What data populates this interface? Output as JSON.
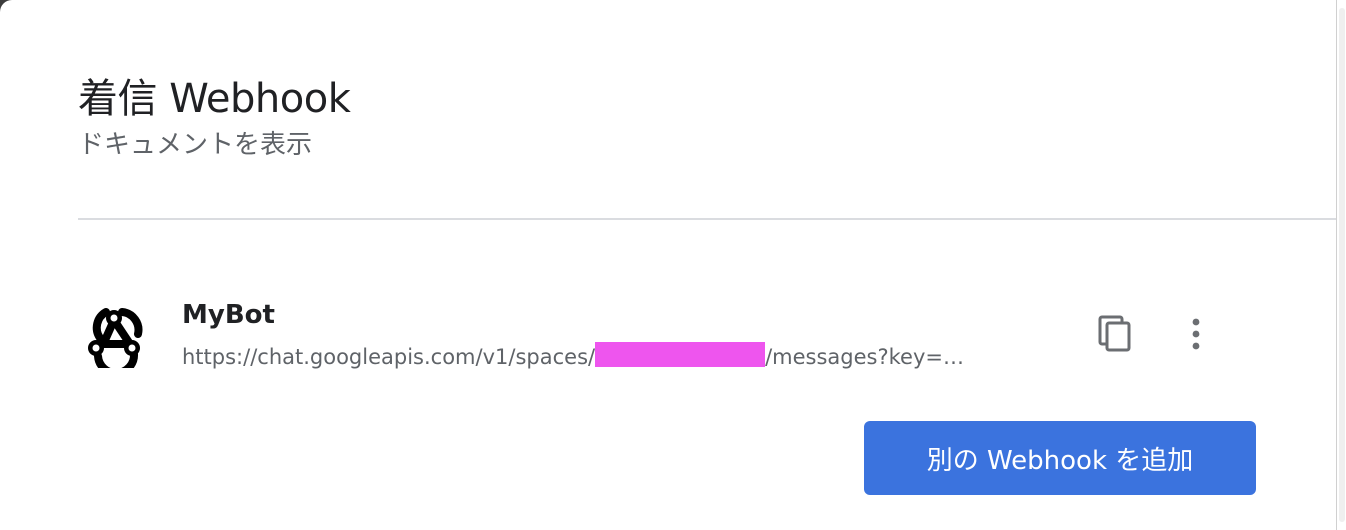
{
  "dialog": {
    "title": "着信 Webhook",
    "docs_link": "ドキュメントを表示"
  },
  "webhooks": [
    {
      "name": "MyBot",
      "url_prefix": "https://chat.googleapis.com/v1/spaces/",
      "url_suffix": "/messages?key=…",
      "icon": "webhook-icon"
    }
  ],
  "actions": {
    "copy_icon": "copy-icon",
    "more_icon": "more-vert-icon",
    "add_button_label": "別の Webhook を追加"
  },
  "colors": {
    "primary": "#3b73de",
    "redaction": "#ee55ee"
  }
}
